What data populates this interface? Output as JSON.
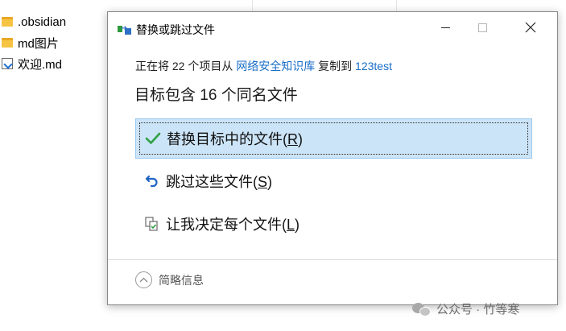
{
  "explorer": {
    "items": [
      {
        "name": ".obsidian",
        "type": "folder"
      },
      {
        "name": "md图片",
        "type": "folder"
      },
      {
        "name": "欢迎.md",
        "type": "markdown-file"
      }
    ]
  },
  "dialog": {
    "title": "替换或跳过文件",
    "copy_prefix": "正在将 22 个项目从 ",
    "source": "网络安全知识库",
    "copy_middle": " 复制到 ",
    "destination": "123test",
    "headline": "目标包含 16 个同名文件",
    "options": [
      {
        "label_before": "替换目标中的文件(",
        "hotkey": "R",
        "label_after": ")",
        "icon": "checkmark-icon",
        "selected": true
      },
      {
        "label_before": "跳过这些文件(",
        "hotkey": "S",
        "label_after": ")",
        "icon": "skip-arrow-icon",
        "selected": false
      },
      {
        "label_before": "让我决定每个文件(",
        "hotkey": "L",
        "label_after": ")",
        "icon": "compare-files-icon",
        "selected": false
      }
    ],
    "details_label": "简略信息"
  },
  "watermark": {
    "text": "公众号 · 竹等寒"
  },
  "colors": {
    "link": "#1a6ec7",
    "selection_bg": "#cce4f7",
    "selection_border": "#99c9ef",
    "check_green": "#2ea043",
    "skip_blue": "#1f63c4"
  }
}
